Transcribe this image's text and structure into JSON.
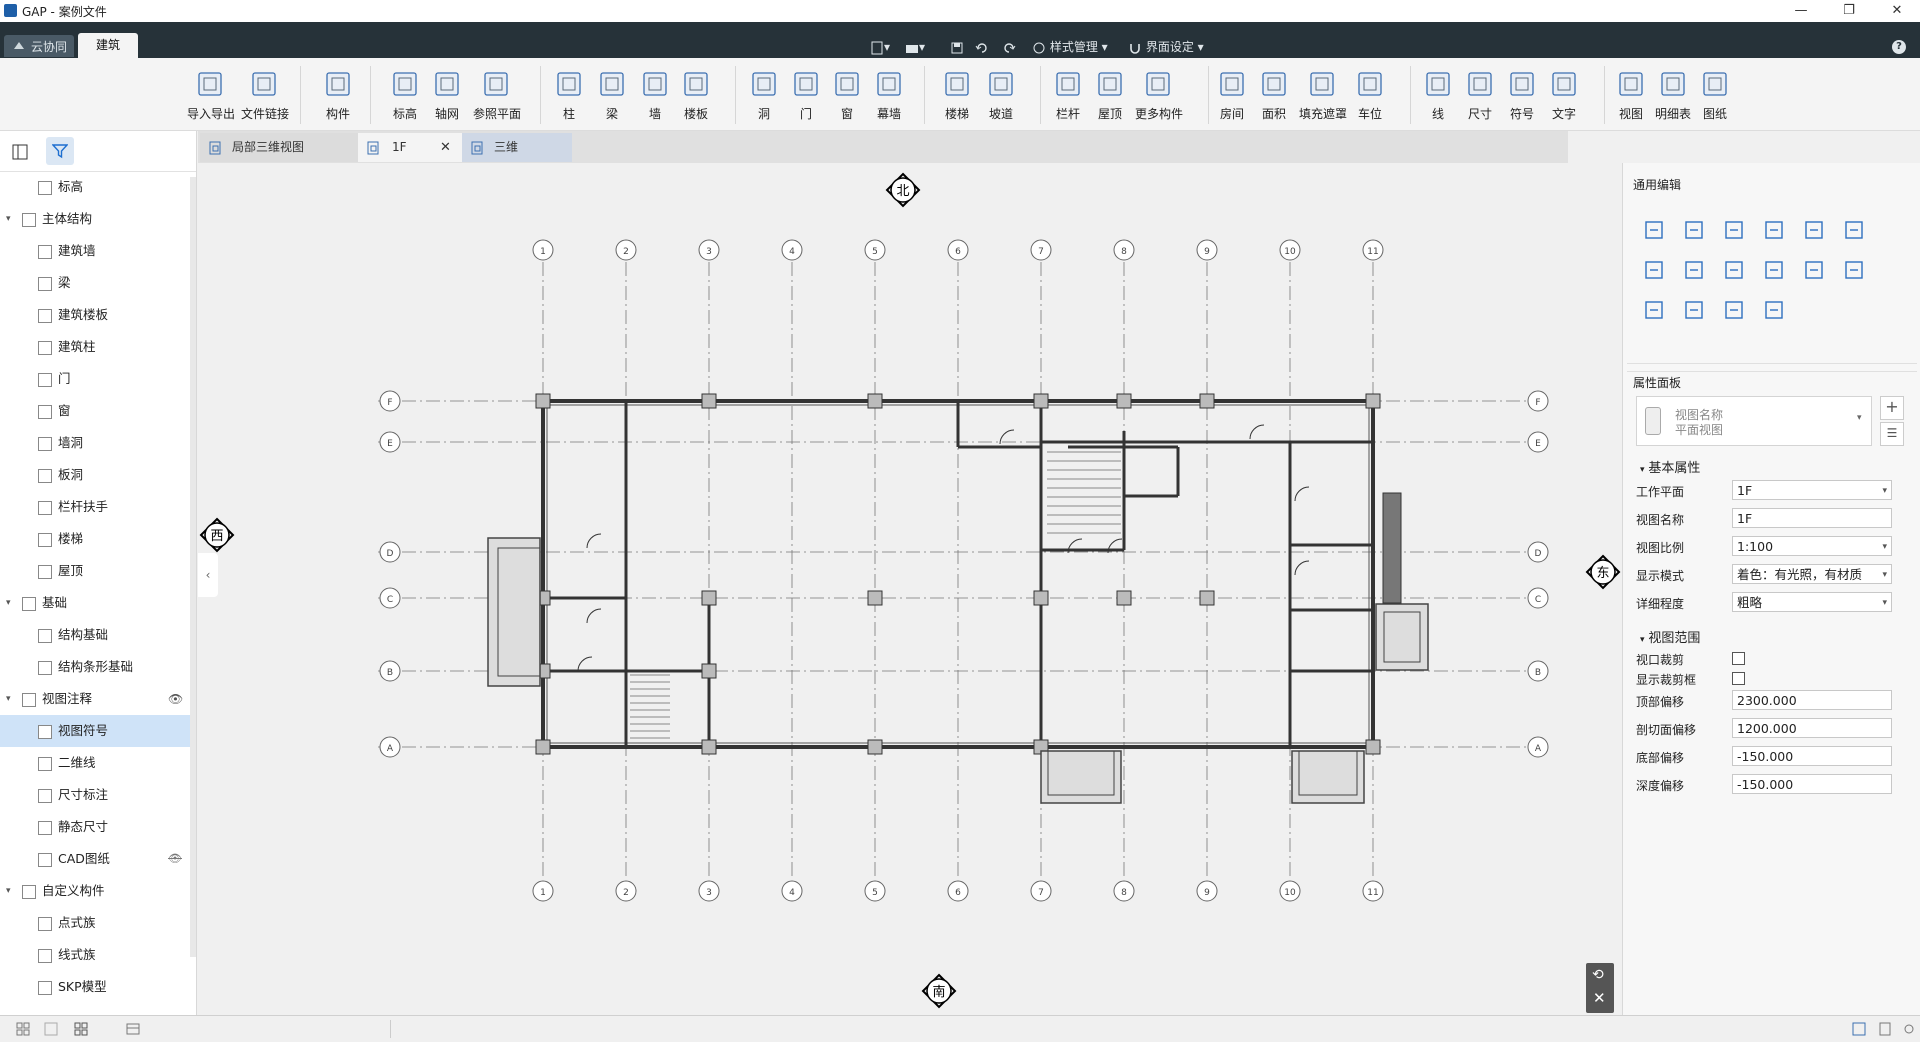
{
  "window": {
    "title": "GAP - 案例文件",
    "minimize": "—",
    "restore": "❐",
    "close": "✕"
  },
  "menubar": {
    "cloud_tab": "云协同",
    "build_tab": "建筑",
    "style_mgmt": "样式管理",
    "ui_settings": "界面设定",
    "help": "?"
  },
  "ribbon": {
    "buttons": [
      "导入导出",
      "文件链接",
      "构件",
      "标高",
      "轴网",
      "参照平面",
      "柱",
      "梁",
      "墙",
      "楼板",
      "洞",
      "门",
      "窗",
      "幕墙",
      "楼梯",
      "坡道",
      "栏杆",
      "屋顶",
      "更多构件",
      "房间",
      "面积",
      "填充遮罩",
      "车位",
      "线",
      "尺寸",
      "符号",
      "文字",
      "视图",
      "明细表",
      "图纸"
    ]
  },
  "tree": {
    "items": [
      {
        "label": "标高",
        "level": 2
      },
      {
        "label": "主体结构",
        "level": 1
      },
      {
        "label": "建筑墙",
        "level": 2
      },
      {
        "label": "梁",
        "level": 2
      },
      {
        "label": "建筑楼板",
        "level": 2
      },
      {
        "label": "建筑柱",
        "level": 2
      },
      {
        "label": "门",
        "level": 2
      },
      {
        "label": "窗",
        "level": 2
      },
      {
        "label": "墙洞",
        "level": 2
      },
      {
        "label": "板洞",
        "level": 2
      },
      {
        "label": "栏杆扶手",
        "level": 2
      },
      {
        "label": "楼梯",
        "level": 2
      },
      {
        "label": "屋顶",
        "level": 2
      },
      {
        "label": "基础",
        "level": 1
      },
      {
        "label": "结构基础",
        "level": 2
      },
      {
        "label": "结构条形基础",
        "level": 2
      },
      {
        "label": "视图注释",
        "level": 1
      },
      {
        "label": "视图符号",
        "level": 2
      },
      {
        "label": "二维线",
        "level": 2
      },
      {
        "label": "尺寸标注",
        "level": 2
      },
      {
        "label": "静态尺寸",
        "level": 2
      },
      {
        "label": "CAD图纸",
        "level": 2
      },
      {
        "label": "自定义构件",
        "level": 1
      },
      {
        "label": "点式族",
        "level": 2
      },
      {
        "label": "线式族",
        "level": 2
      },
      {
        "label": "SKP模型",
        "level": 2
      }
    ]
  },
  "doc_tabs": [
    "局部三维视图",
    "1F",
    "三维"
  ],
  "compass": {
    "north": "北",
    "south": "南",
    "west": "西",
    "east": "东"
  },
  "grid": {
    "vertical": [
      "1",
      "2",
      "3",
      "4",
      "5",
      "6",
      "7",
      "8",
      "9",
      "10",
      "11"
    ],
    "horizontal": [
      "F",
      "E",
      "D",
      "C",
      "B",
      "A"
    ]
  },
  "right": {
    "general_edit": "通用编辑",
    "prop_panel": "属性面板",
    "view_name_label": "视图名称",
    "view_type": "平面视图",
    "basic_props": "基本属性",
    "view_range": "视图范围",
    "props": [
      {
        "key": "工作平面",
        "value": "1F",
        "dropdown": true
      },
      {
        "key": "视图名称",
        "value": "1F",
        "dropdown": false
      },
      {
        "key": "视图比例",
        "value": "1:100",
        "dropdown": true
      },
      {
        "key": "显示模式",
        "value": "着色：有光照，有材质",
        "dropdown": true
      },
      {
        "key": "详细程度",
        "value": "粗略",
        "dropdown": true
      }
    ],
    "checks": [
      {
        "key": "视口裁剪",
        "checked": false
      },
      {
        "key": "显示裁剪框",
        "checked": false
      }
    ],
    "range": [
      {
        "key": "顶部偏移",
        "value": "2300.000"
      },
      {
        "key": "剖切面偏移",
        "value": "1200.000"
      },
      {
        "key": "底部偏移",
        "value": "-150.000"
      },
      {
        "key": "深度偏移",
        "value": "-150.000"
      }
    ]
  }
}
